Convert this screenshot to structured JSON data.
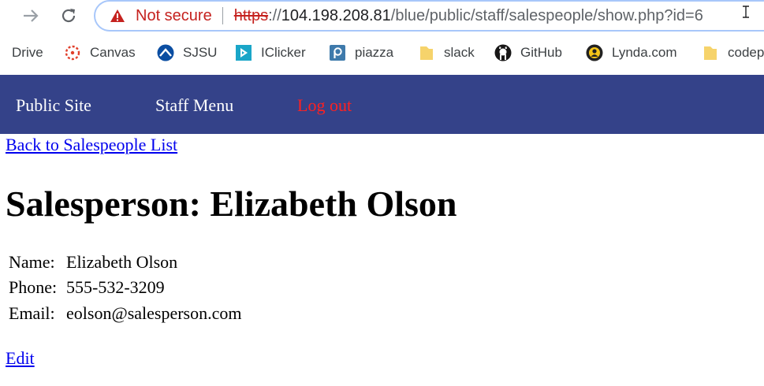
{
  "browser": {
    "security_label": "Not secure",
    "url_scheme": "https",
    "url_scheme_sep": "://",
    "url_host": "104.198.208.81",
    "url_path": "/blue/public/staff/salespeople/show.php?id=6",
    "warning_color": "#c5221f"
  },
  "bookmarks": [
    {
      "label": "Drive",
      "icon": "drive-icon"
    },
    {
      "label": "Canvas",
      "icon": "canvas-icon"
    },
    {
      "label": "SJSU",
      "icon": "sjsu-icon"
    },
    {
      "label": "IClicker",
      "icon": "iclicker-icon"
    },
    {
      "label": "piazza",
      "icon": "piazza-icon"
    },
    {
      "label": "slack",
      "icon": "folder-icon"
    },
    {
      "label": "GitHub",
      "icon": "github-icon"
    },
    {
      "label": "Lynda.com",
      "icon": "lynda-icon"
    },
    {
      "label": "codep",
      "icon": "folder-icon"
    }
  ],
  "nav": {
    "public_site": "Public Site",
    "staff_menu": "Staff Menu",
    "log_out": "Log out",
    "bar_color": "#344289"
  },
  "page": {
    "back_link": "Back to Salespeople List",
    "title": "Salesperson: Elizabeth Olson",
    "details": {
      "name_label": "Name:",
      "name_value": "Elizabeth Olson",
      "phone_label": "Phone:",
      "phone_value": "555-532-3209",
      "email_label": "Email:",
      "email_value": "eolson@salesperson.com"
    },
    "edit_link": "Edit"
  }
}
